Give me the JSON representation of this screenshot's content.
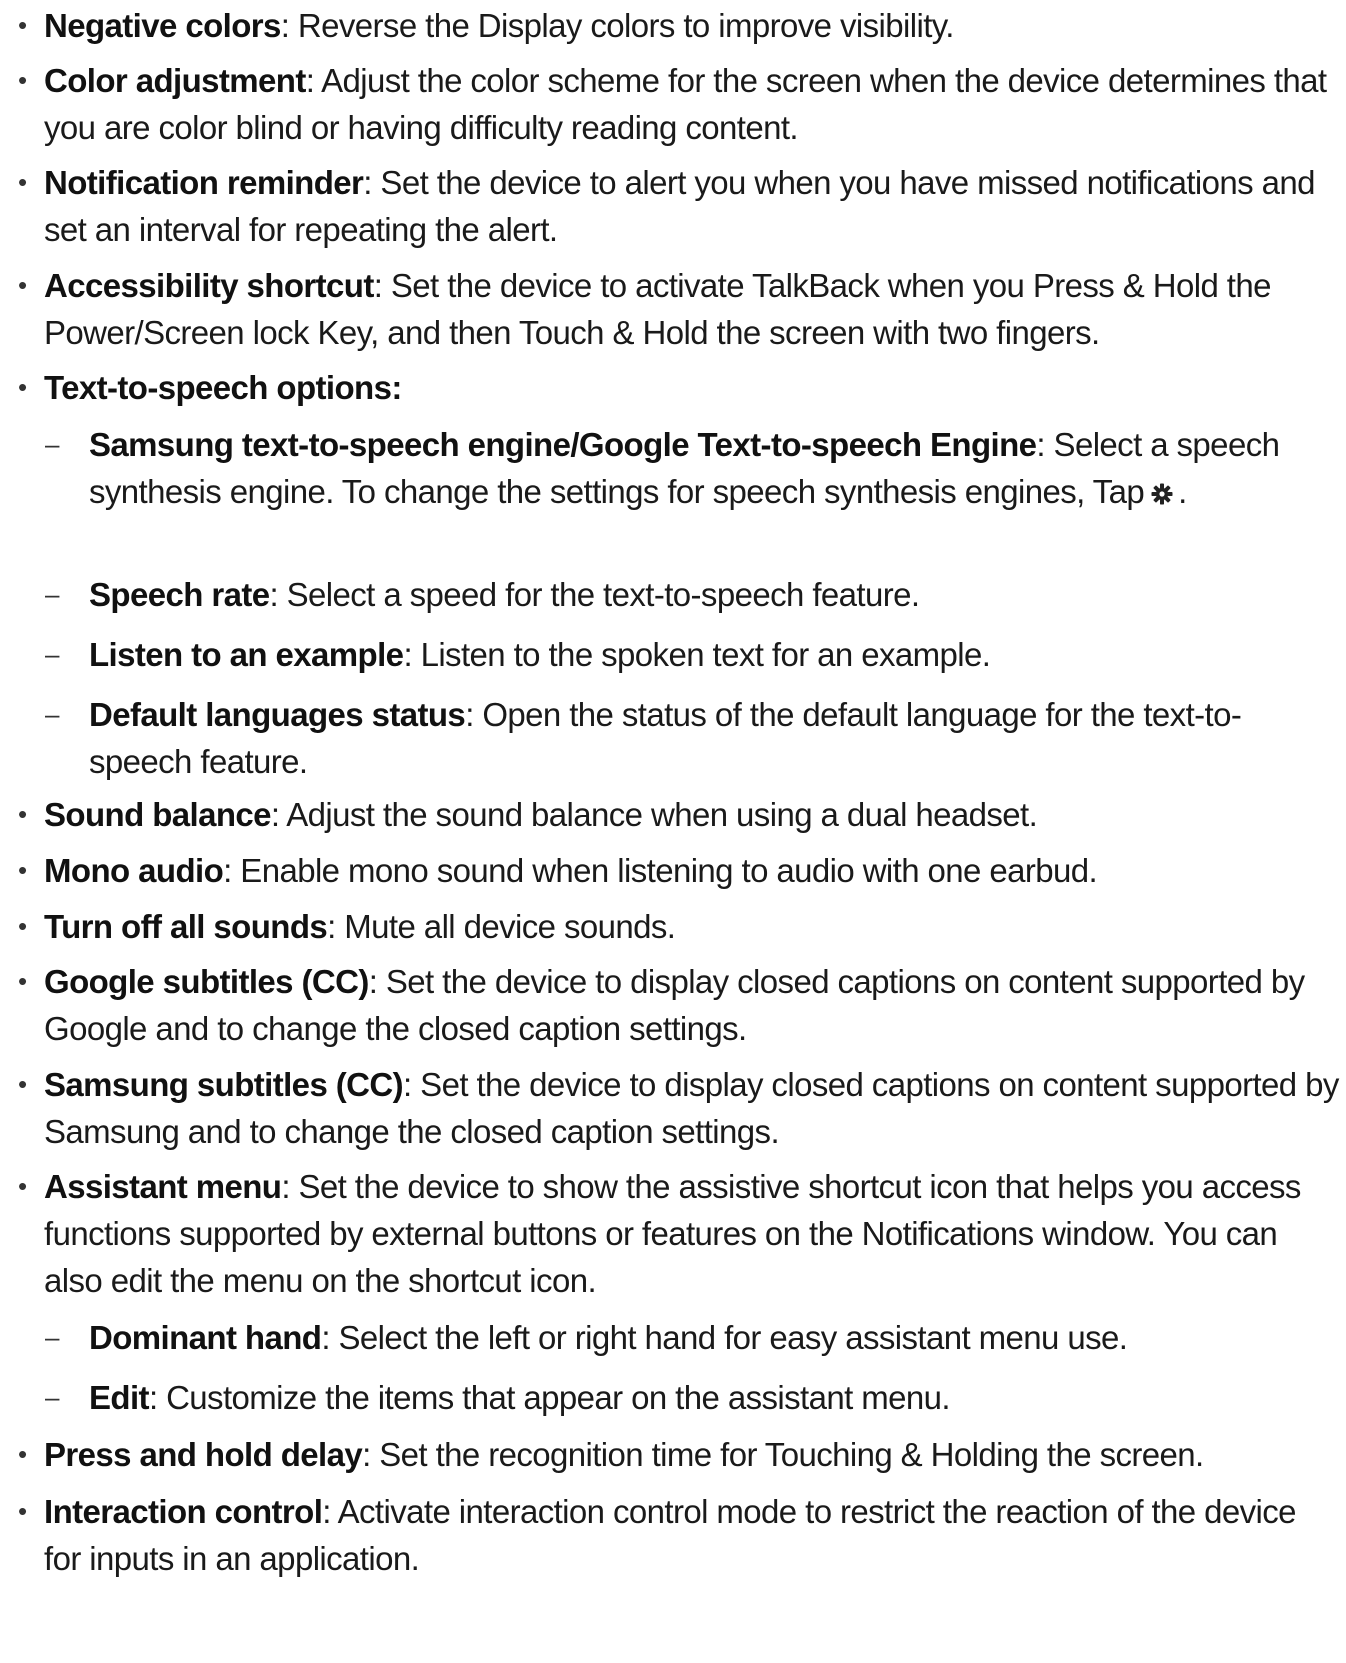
{
  "items": [
    {
      "level": 1,
      "term": "Negative colors",
      "desc": ": Reverse the Display colors to improve visibility."
    },
    {
      "level": 1,
      "term": "Color adjustment",
      "desc": ": Adjust the color scheme for the screen when the device determines that you are color blind or having difficulty reading content."
    },
    {
      "level": 1,
      "term": "Notification reminder",
      "desc": ": Set the device to alert you when you have missed notifications and set an interval for repeating the alert."
    },
    {
      "level": 1,
      "term": "Accessibility shortcut",
      "desc": ": Set the device to activate TalkBack when you Press & Hold the Power/Screen lock Key, and then Touch & Hold the screen with two fingers."
    },
    {
      "level": 1,
      "term": "Text-to-speech options:",
      "desc": ""
    },
    {
      "level": 2,
      "term": "Samsung text-to-speech engine/Google Text-to-speech Engine",
      "desc": ": Select a speech synthesis engine. To change the settings for speech synthesis engines, Tap",
      "icon": "gear-icon",
      "desc_after": "."
    },
    {
      "level": 2,
      "term": "Speech rate",
      "desc": ": Select a speed for the text-to-speech feature."
    },
    {
      "level": 2,
      "term": "Listen to an example",
      "desc": ": Listen to the spoken text for an example."
    },
    {
      "level": 2,
      "term": "Default languages status",
      "desc": ": Open the status of the default language for the text-to-speech feature."
    },
    {
      "level": 1,
      "term": "Sound balance",
      "desc": ": Adjust the sound balance when using a dual headset."
    },
    {
      "level": 1,
      "term": "Mono audio",
      "desc": ": Enable mono sound when listening to audio with one earbud."
    },
    {
      "level": 1,
      "term": "Turn off all sounds",
      "desc": ": Mute all device sounds."
    },
    {
      "level": 1,
      "term": "Google subtitles (CC)",
      "desc": ": Set the device to display closed captions on content supported by Google and to change the closed caption settings."
    },
    {
      "level": 1,
      "term": "Samsung subtitles (CC)",
      "desc": ": Set the device to display closed captions on content supported by Samsung and to change the closed caption settings."
    },
    {
      "level": 1,
      "term": "Assistant menu",
      "desc": ": Set the device to show the assistive shortcut icon that helps you access functions supported by external buttons or features on the Notifications window. You can also edit the menu on the shortcut icon."
    },
    {
      "level": 2,
      "term": "Dominant hand",
      "desc": ": Select the left or right hand for easy assistant menu use."
    },
    {
      "level": 2,
      "term": "Edit",
      "desc": ": Customize the items that appear on the assistant menu."
    },
    {
      "level": 1,
      "term": "Press and hold delay",
      "desc": ": Set the recognition time for Touching & Holding the screen."
    },
    {
      "level": 1,
      "term": "Interaction control",
      "desc": ": Activate interaction control mode to restrict the reaction of the device for inputs in an application."
    }
  ]
}
